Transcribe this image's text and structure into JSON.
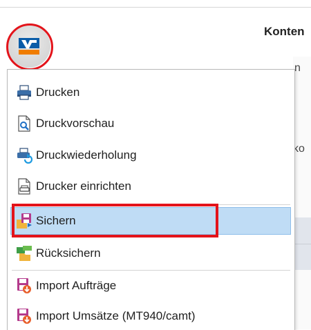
{
  "background": {
    "title": "Konten",
    "fragment_a": "n",
    "fragment_b": "ko"
  },
  "app_button": {
    "icon": "volksbank-logo-icon"
  },
  "menu": {
    "items": [
      {
        "label": "Drucken",
        "icon": "printer-icon"
      },
      {
        "label": "Druckvorschau",
        "icon": "print-preview-icon"
      },
      {
        "label": "Druckwiederholung",
        "icon": "print-repeat-icon"
      },
      {
        "label": "Drucker einrichten",
        "icon": "printer-setup-icon"
      },
      {
        "label": "Sichern",
        "icon": "save-backup-icon",
        "highlighted": true
      },
      {
        "label": "Rücksichern",
        "icon": "restore-backup-icon"
      },
      {
        "label": "Import Aufträge",
        "icon": "import-orders-icon"
      },
      {
        "label": "Import Umsätze (MT940/camt)",
        "icon": "import-transactions-icon"
      }
    ]
  },
  "colors": {
    "accent_red": "#e3141b",
    "brand_blue": "#0a5ca8",
    "brand_orange": "#f07d00",
    "hover_blue": "#bfdcf5"
  }
}
